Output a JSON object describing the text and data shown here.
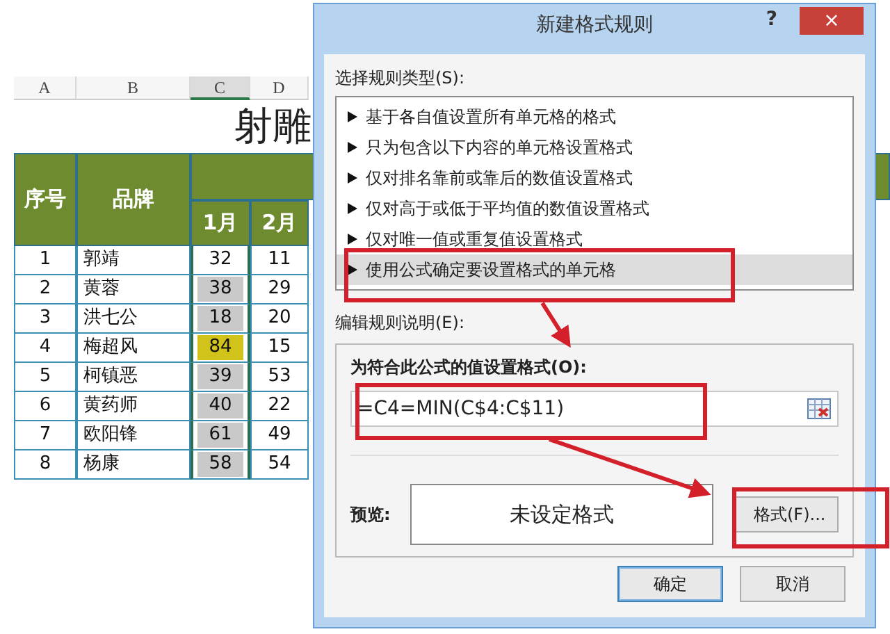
{
  "sheet": {
    "columns": [
      {
        "label": "A",
        "selected": false
      },
      {
        "label": "B",
        "selected": false
      },
      {
        "label": "C",
        "selected": true
      },
      {
        "label": "D",
        "selected": false
      }
    ],
    "title": "射雕",
    "headers": {
      "index": "序号",
      "name": "品牌",
      "months": [
        "1月",
        "2月"
      ]
    },
    "rows": [
      {
        "no": "1",
        "name": "郭靖",
        "jan": {
          "value": "32",
          "color": "#ffffff"
        },
        "feb": "11"
      },
      {
        "no": "2",
        "name": "黄蓉",
        "jan": {
          "value": "38",
          "color": "#c9c9c9"
        },
        "feb": "29"
      },
      {
        "no": "3",
        "name": "洪七公",
        "jan": {
          "value": "18",
          "color": "#c9c9c9"
        },
        "feb": "20"
      },
      {
        "no": "4",
        "name": "梅超风",
        "jan": {
          "value": "84",
          "color": "#d2c31a"
        },
        "feb": "15"
      },
      {
        "no": "5",
        "name": "柯镇恶",
        "jan": {
          "value": "39",
          "color": "#c9c9c9"
        },
        "feb": "53"
      },
      {
        "no": "6",
        "name": "黄药师",
        "jan": {
          "value": "40",
          "color": "#c9c9c9"
        },
        "feb": "22"
      },
      {
        "no": "7",
        "name": "欧阳锋",
        "jan": {
          "value": "61",
          "color": "#c9c9c9"
        },
        "feb": "49"
      },
      {
        "no": "8",
        "name": "杨康",
        "jan": {
          "value": "58",
          "color": "#c9c9c9"
        },
        "feb": "54"
      }
    ]
  },
  "dialog": {
    "title": "新建格式规则",
    "help": "?",
    "close": "×",
    "rule_type_label": "选择规则类型(S):",
    "rule_types": [
      {
        "label": "基于各自值设置所有单元格的格式",
        "selected": false
      },
      {
        "label": "只为包含以下内容的单元格设置格式",
        "selected": false
      },
      {
        "label": "仅对排名靠前或靠后的数值设置格式",
        "selected": false
      },
      {
        "label": "仅对高于或低于平均值的数值设置格式",
        "selected": false
      },
      {
        "label": "仅对唯一值或重复值设置格式",
        "selected": false
      },
      {
        "label": "使用公式确定要设置格式的单元格",
        "selected": true
      }
    ],
    "description_label": "编辑规则说明(E):",
    "formula_label": "为符合此公式的值设置格式(O):",
    "formula": "=C4=MIN(C$4:C$11)",
    "preview_label": "预览:",
    "preview_text": "未设定格式",
    "format_button": "格式(F)...",
    "buttons": [
      {
        "label": "确定",
        "default": true
      },
      {
        "label": "取消",
        "default": false
      }
    ]
  }
}
